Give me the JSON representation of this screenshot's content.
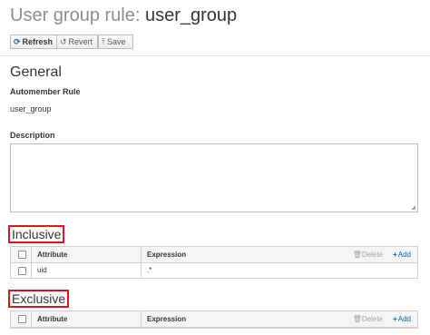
{
  "header": {
    "prefix": "User group rule:",
    "name": "user_group"
  },
  "toolbar": {
    "refresh": "Refresh",
    "revert": "Revert",
    "save": "Save"
  },
  "general": {
    "title": "General",
    "automember_label": "Automember Rule",
    "automember_value": "user_group",
    "description_label": "Description",
    "description_value": ""
  },
  "inclusive": {
    "title": "Inclusive",
    "columns": [
      "Attribute",
      "Expression"
    ],
    "delete_label": "Delete",
    "add_label": "Add",
    "rows": [
      {
        "attribute": "uid",
        "expression": ".*"
      }
    ]
  },
  "exclusive": {
    "title": "Exclusive",
    "columns": [
      "Attribute",
      "Expression"
    ],
    "delete_label": "Delete",
    "add_label": "Add",
    "rows": []
  },
  "icons": {
    "refresh": "refresh-icon",
    "revert": "undo-icon",
    "save": "upload-icon",
    "delete": "trash-icon",
    "add": "plus-icon"
  },
  "colors": {
    "highlight": "#d71920",
    "link": "#0066bf",
    "primary_icon": "#2a6fb3"
  }
}
